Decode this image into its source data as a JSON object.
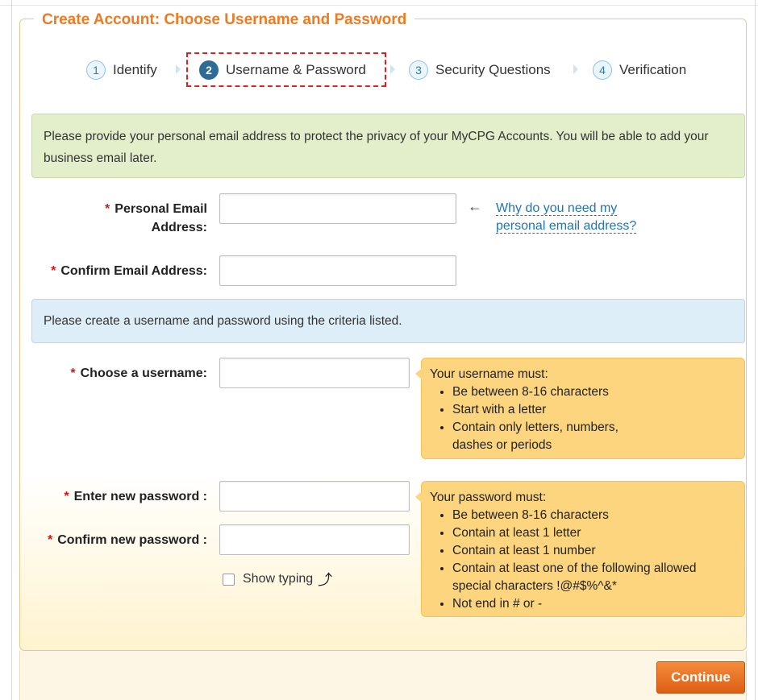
{
  "title": "Create Account: Choose Username and Password",
  "steps": [
    {
      "num": "1",
      "label": "Identify"
    },
    {
      "num": "2",
      "label": "Username & Password"
    },
    {
      "num": "3",
      "label": "Security Questions"
    },
    {
      "num": "4",
      "label": "Verification"
    }
  ],
  "active_step": 2,
  "email_notice": "Please provide your personal email address to protect the privacy of your MyCPG Accounts. You will be able to add your business email later.",
  "fields": {
    "required_mark": "*",
    "personal_email_label_1": "Personal Email",
    "personal_email_label_2": "Address:",
    "confirm_email_label": "Confirm Email Address:",
    "username_label": "Choose a username:",
    "new_password_label": "Enter new password :",
    "confirm_password_label": "Confirm new password :"
  },
  "why_arrow": "←",
  "why_link": "Why do you need my personal email address?",
  "credentials_notice": "Please create a username and password using the criteria listed.",
  "username_tip": {
    "heading": "Your username must:",
    "items": [
      "Be between 8-16 characters",
      "Start with a letter",
      "Contain only letters, numbers, dashes or periods"
    ]
  },
  "password_tip": {
    "heading": "Your password must:",
    "items": [
      "Be between 8-16 characters",
      "Contain at least 1 letter",
      "Contain at least 1 number",
      "Contain at least one of the following allowed special characters !@#$%^&*",
      "Not end in # or -"
    ]
  },
  "show_typing": "Show typing",
  "show_typing_icon": "⤴",
  "continue_label": "Continue",
  "colors": {
    "accent": "#ee7a22",
    "link": "#1f74b5",
    "tip_bg": "#fdd57e",
    "required": "#d01818"
  }
}
